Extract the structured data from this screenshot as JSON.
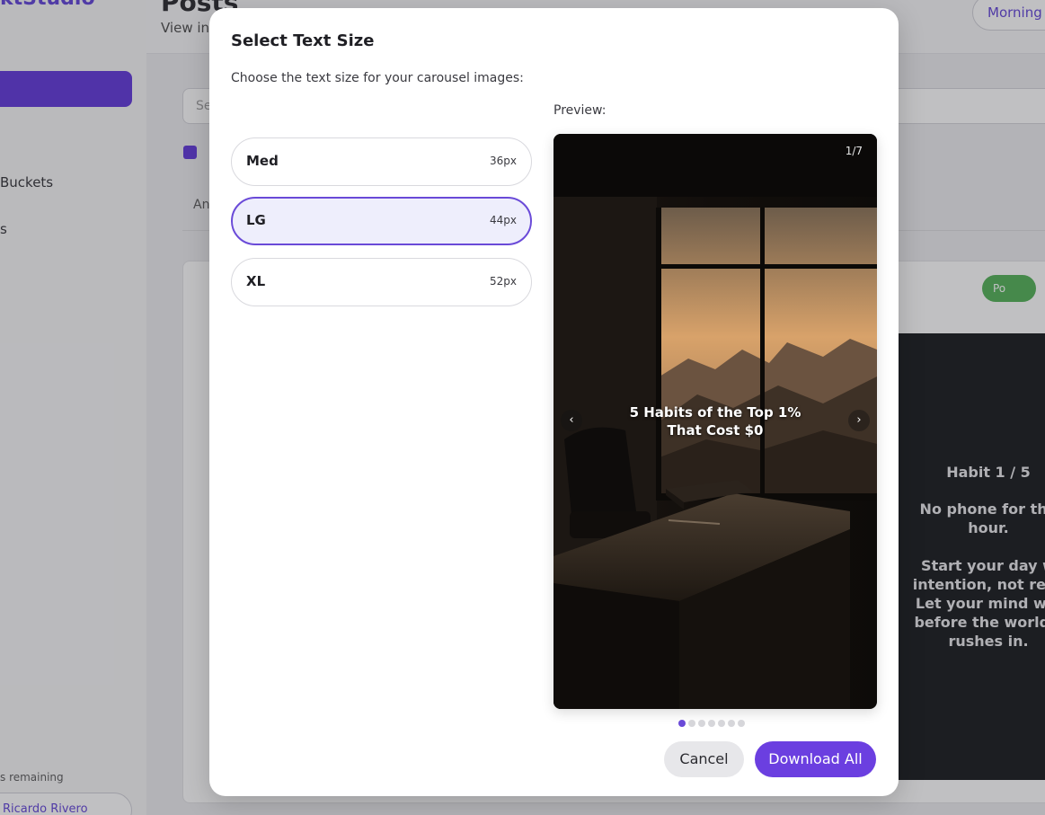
{
  "background": {
    "brand_text": "ktStudio",
    "sidebar": {
      "items": [
        "Buckets",
        "s"
      ],
      "credits_text": "s remaining",
      "user_name": "Ricardo Rivero"
    },
    "header": {
      "title": "Posts",
      "subtitle": "View in",
      "profile_button": "Morning"
    },
    "search_placeholder": "Se",
    "filter_label": "F",
    "tab_label": "An",
    "post": {
      "badge": "Po",
      "slide_lines": [
        "Habit 1 / 5",
        "No phone for the",
        "hour.",
        "Start your day w",
        "intention, not reac",
        "Let your mind wal",
        "before the world's",
        "rushes in."
      ]
    }
  },
  "modal": {
    "title": "Select Text Size",
    "description": "Choose the text size for your carousel images:",
    "preview_label": "Preview:",
    "options": [
      {
        "name": "Med",
        "size": "36px",
        "selected": false
      },
      {
        "name": "LG",
        "size": "44px",
        "selected": true
      },
      {
        "name": "XL",
        "size": "52px",
        "selected": false
      }
    ],
    "preview": {
      "counter": "1/7",
      "text_line1": "5 Habits of the Top 1%",
      "text_line2": "That Cost $0",
      "prev_icon": "‹",
      "next_icon": "›",
      "total_slides": 7,
      "current_slide": 1
    },
    "cancel_label": "Cancel",
    "download_label": "Download All"
  },
  "colors": {
    "accent": "#6b3fe0",
    "selected_bg": "#eeeefc",
    "success": "#4caf50"
  }
}
